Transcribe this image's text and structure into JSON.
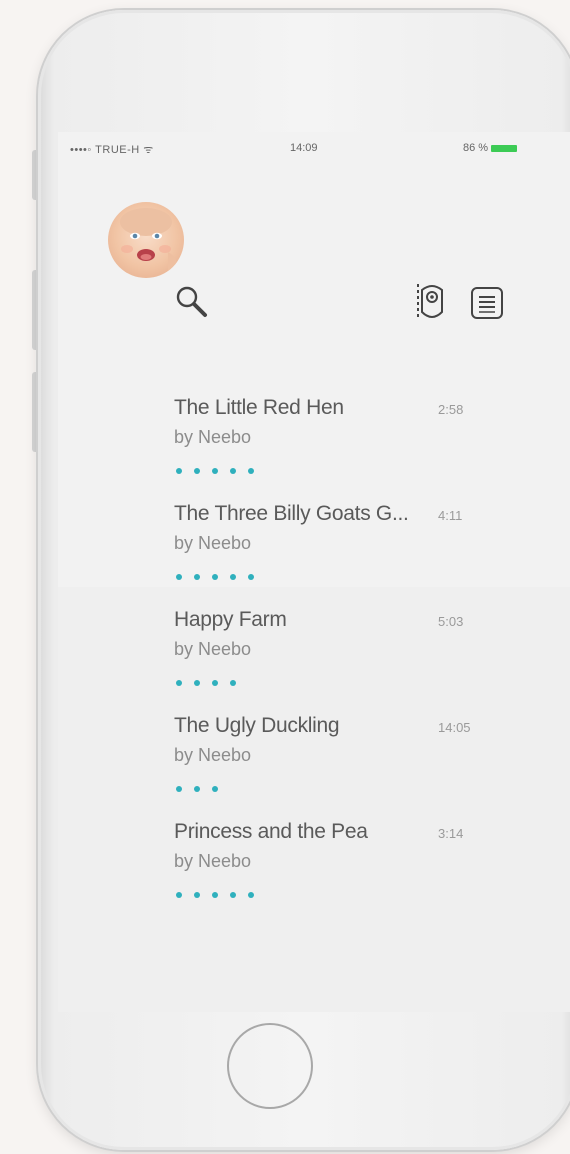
{
  "status_bar": {
    "carrier": "••••◦ TRUE-H ᯤ",
    "time": "14:09",
    "battery": "86 %",
    "battery_color": "#3ccb55"
  },
  "header": {
    "avatar": "baby-face-avatar",
    "search_icon": "search-icon",
    "remote_icon": "remote-control-icon",
    "menu_icon": "list-menu-icon"
  },
  "stories": [
    {
      "title": "The Little Red Hen",
      "author": "by Neebo",
      "duration": "2:58",
      "rating": 5
    },
    {
      "title": "The Three Billy Goats G...",
      "author": "by Neebo",
      "duration": "4:11",
      "rating": 5
    },
    {
      "title": "Happy Farm",
      "author": "by Neebo",
      "duration": "5:03",
      "rating": 4
    },
    {
      "title": "The Ugly Duckling",
      "author": "by Neebo",
      "duration": "14:05",
      "rating": 3
    },
    {
      "title": "Princess and the Pea",
      "author": "by Neebo",
      "duration": "3:14",
      "rating": 5
    }
  ],
  "colors": {
    "accent": "#2fb0bd",
    "title_text": "#5a5a5a",
    "secondary_text": "#8c8c8c"
  }
}
